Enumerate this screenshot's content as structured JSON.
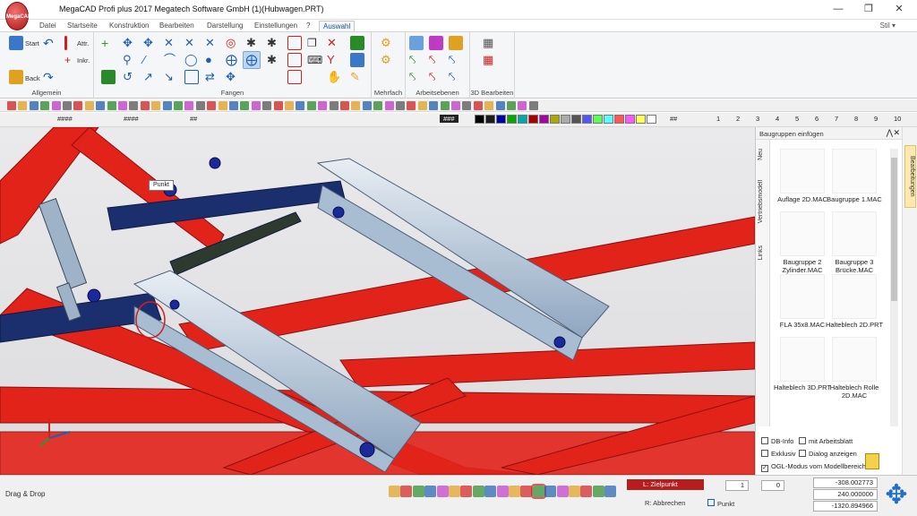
{
  "window": {
    "title": "MegaCAD Profi plus 2017  Megatech Software GmbH (1)(Hubwagen.PRT)",
    "logo_text": "MegaCAD"
  },
  "menu": {
    "tabs": [
      "Datei",
      "Startseite",
      "Konstruktion",
      "Bearbeiten",
      "Darstellung",
      "Einstellungen",
      "?",
      "Auswahl"
    ],
    "active": "Auswahl",
    "style_label": "Stil"
  },
  "ribbon": {
    "groups": [
      "Allgemein",
      "Fangen",
      "Mehrfach",
      "Arbeitsebenen",
      "3D Bearbeiten"
    ],
    "allgemein": {
      "start": "Start",
      "back": "Back",
      "attr": "Attr.",
      "inkr": "Inkr."
    }
  },
  "toolbar": {
    "hash1": "####",
    "hash2": "####",
    "hash3": "##",
    "hash4": "###",
    "hash5": "##",
    "numbers": [
      "1",
      "2",
      "3",
      "4",
      "5",
      "6",
      "7",
      "8",
      "9",
      "10"
    ]
  },
  "colors": {
    "palette": [
      "#000000",
      "#1c1c1c",
      "#0000aa",
      "#00aa00",
      "#00aaaa",
      "#aa0000",
      "#aa00aa",
      "#aaaa00",
      "#aaaaaa",
      "#555555",
      "#5555ff",
      "#55ff55",
      "#55ffff",
      "#ff5555",
      "#ff55ff",
      "#ffff55",
      "#ffffff"
    ],
    "frame": "#e2231a",
    "bar": "#1b2f6e",
    "steel": "#9fb3c8"
  },
  "sidepanel": {
    "title": "Baugruppen einfügen",
    "vtabs": [
      "Neu",
      "Vertriebsmodell",
      "Links"
    ],
    "side_tab": "Bearbeitungen",
    "items": [
      {
        "label": "Auflage 2D.MAC"
      },
      {
        "label": "Baugruppe 1.MAC"
      },
      {
        "label": "Baugruppe 2 Zylinder.MAC"
      },
      {
        "label": "Baugruppe 3 Brücke.MAC"
      },
      {
        "label": "FLA 35x8.MAC"
      },
      {
        "label": "Halteblech 2D.PRT"
      },
      {
        "label": "Halteblech 3D.PRT"
      },
      {
        "label": "Halteblech Rolle 2D.MAC"
      }
    ],
    "checks": {
      "dbinfo": "DB-Info",
      "arbeitsblatt": "mit Arbeitsblatt",
      "exklusiv": "Exklusiv",
      "dialog": "Dialog anzeigen",
      "ogl": "OGL-Modus vom Modellbereich"
    }
  },
  "viewport": {
    "callout": "Punkt"
  },
  "status": {
    "left": "Drag & Drop",
    "prompt": "L: Zielpunkt",
    "abbrechen": "R: Abbrechen",
    "punkt": "Punkt",
    "field1": "1",
    "field2": "0",
    "x": "-308.002773",
    "y": "240.000000",
    "z": "-1320.894966"
  }
}
